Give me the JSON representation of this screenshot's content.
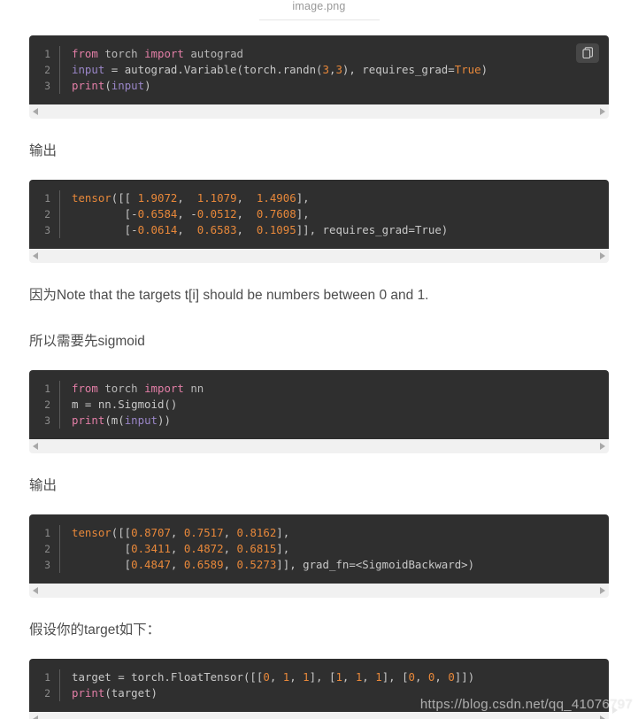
{
  "image_caption": "image.png",
  "copy_button_label": "copy-code",
  "scrollbar": {
    "left_arrow": "◀",
    "right_arrow": "▶"
  },
  "blocks": [
    {
      "kind": "code",
      "id": "code-autograd",
      "has_copy_button": true,
      "lines": [
        {
          "number": "1",
          "tokens": [
            {
              "t": "kw",
              "s": "from"
            },
            {
              "t": "plain",
              "s": " "
            },
            {
              "t": "name",
              "s": "torch"
            },
            {
              "t": "plain",
              "s": " "
            },
            {
              "t": "kw",
              "s": "import"
            },
            {
              "t": "plain",
              "s": " "
            },
            {
              "t": "name",
              "s": "autograd"
            }
          ]
        },
        {
          "number": "2",
          "tokens": [
            {
              "t": "var",
              "s": "input"
            },
            {
              "t": "plain",
              "s": " = autograd.Variable(torch.randn("
            },
            {
              "t": "num",
              "s": "3"
            },
            {
              "t": "plain",
              "s": ","
            },
            {
              "t": "num",
              "s": "3"
            },
            {
              "t": "plain",
              "s": "), requires_grad="
            },
            {
              "t": "bool",
              "s": "True"
            },
            {
              "t": "plain",
              "s": ")"
            }
          ]
        },
        {
          "number": "3",
          "tokens": [
            {
              "t": "kw",
              "s": "print"
            },
            {
              "t": "plain",
              "s": "("
            },
            {
              "t": "var",
              "s": "input"
            },
            {
              "t": "plain",
              "s": ")"
            }
          ]
        }
      ]
    },
    {
      "kind": "para",
      "id": "para-output-1",
      "text": "输出"
    },
    {
      "kind": "code",
      "id": "code-tensor-output",
      "has_copy_button": false,
      "lines": [
        {
          "number": "1",
          "tokens": [
            {
              "t": "tensor",
              "s": "tensor"
            },
            {
              "t": "plain",
              "s": "([[ "
            },
            {
              "t": "num",
              "s": "1.9072"
            },
            {
              "t": "plain",
              "s": ",  "
            },
            {
              "t": "num",
              "s": "1.1079"
            },
            {
              "t": "plain",
              "s": ",  "
            },
            {
              "t": "num",
              "s": "1.4906"
            },
            {
              "t": "plain",
              "s": "],"
            }
          ]
        },
        {
          "number": "2",
          "tokens": [
            {
              "t": "plain",
              "s": "        [-"
            },
            {
              "t": "num",
              "s": "0.6584"
            },
            {
              "t": "plain",
              "s": ", -"
            },
            {
              "t": "num",
              "s": "0.0512"
            },
            {
              "t": "plain",
              "s": ",  "
            },
            {
              "t": "num",
              "s": "0.7608"
            },
            {
              "t": "plain",
              "s": "],"
            }
          ]
        },
        {
          "number": "3",
          "tokens": [
            {
              "t": "plain",
              "s": "        [-"
            },
            {
              "t": "num",
              "s": "0.0614"
            },
            {
              "t": "plain",
              "s": ",  "
            },
            {
              "t": "num",
              "s": "0.6583"
            },
            {
              "t": "plain",
              "s": ",  "
            },
            {
              "t": "num",
              "s": "0.1095"
            },
            {
              "t": "plain",
              "s": "]], requires_grad=True)"
            }
          ]
        }
      ]
    },
    {
      "kind": "para",
      "id": "para-note",
      "text": "因为Note that the targets t[i] should be numbers between 0 and 1."
    },
    {
      "kind": "para",
      "id": "para-sigmoid-note",
      "text": "所以需要先sigmoid"
    },
    {
      "kind": "code",
      "id": "code-sigmoid",
      "has_copy_button": false,
      "lines": [
        {
          "number": "1",
          "tokens": [
            {
              "t": "kw",
              "s": "from"
            },
            {
              "t": "plain",
              "s": " "
            },
            {
              "t": "name",
              "s": "torch"
            },
            {
              "t": "plain",
              "s": " "
            },
            {
              "t": "kw",
              "s": "import"
            },
            {
              "t": "plain",
              "s": " "
            },
            {
              "t": "name",
              "s": "nn"
            }
          ]
        },
        {
          "number": "2",
          "tokens": [
            {
              "t": "plain",
              "s": "m = nn.Sigmoid()"
            }
          ]
        },
        {
          "number": "3",
          "tokens": [
            {
              "t": "kw",
              "s": "print"
            },
            {
              "t": "plain",
              "s": "(m("
            },
            {
              "t": "var",
              "s": "input"
            },
            {
              "t": "plain",
              "s": "))"
            }
          ]
        }
      ]
    },
    {
      "kind": "para",
      "id": "para-output-2",
      "text": "输出"
    },
    {
      "kind": "code",
      "id": "code-sigmoid-output",
      "has_copy_button": false,
      "lines": [
        {
          "number": "1",
          "tokens": [
            {
              "t": "tensor",
              "s": "tensor"
            },
            {
              "t": "plain",
              "s": "([["
            },
            {
              "t": "num",
              "s": "0.8707"
            },
            {
              "t": "plain",
              "s": ", "
            },
            {
              "t": "num",
              "s": "0.7517"
            },
            {
              "t": "plain",
              "s": ", "
            },
            {
              "t": "num",
              "s": "0.8162"
            },
            {
              "t": "plain",
              "s": "],"
            }
          ]
        },
        {
          "number": "2",
          "tokens": [
            {
              "t": "plain",
              "s": "        ["
            },
            {
              "t": "num",
              "s": "0.3411"
            },
            {
              "t": "plain",
              "s": ", "
            },
            {
              "t": "num",
              "s": "0.4872"
            },
            {
              "t": "plain",
              "s": ", "
            },
            {
              "t": "num",
              "s": "0.6815"
            },
            {
              "t": "plain",
              "s": "],"
            }
          ]
        },
        {
          "number": "3",
          "tokens": [
            {
              "t": "plain",
              "s": "        ["
            },
            {
              "t": "num",
              "s": "0.4847"
            },
            {
              "t": "plain",
              "s": ", "
            },
            {
              "t": "num",
              "s": "0.6589"
            },
            {
              "t": "plain",
              "s": ", "
            },
            {
              "t": "num",
              "s": "0.5273"
            },
            {
              "t": "plain",
              "s": "]], grad_fn=<SigmoidBackward>)"
            }
          ]
        }
      ]
    },
    {
      "kind": "para",
      "id": "para-target-intro",
      "text": "假设你的target如下："
    },
    {
      "kind": "code",
      "id": "code-target",
      "has_copy_button": false,
      "lines": [
        {
          "number": "1",
          "tokens": [
            {
              "t": "plain",
              "s": "target = torch.FloatTensor([["
            },
            {
              "t": "num",
              "s": "0"
            },
            {
              "t": "plain",
              "s": ", "
            },
            {
              "t": "num",
              "s": "1"
            },
            {
              "t": "plain",
              "s": ", "
            },
            {
              "t": "num",
              "s": "1"
            },
            {
              "t": "plain",
              "s": "], ["
            },
            {
              "t": "num",
              "s": "1"
            },
            {
              "t": "plain",
              "s": ", "
            },
            {
              "t": "num",
              "s": "1"
            },
            {
              "t": "plain",
              "s": ", "
            },
            {
              "t": "num",
              "s": "1"
            },
            {
              "t": "plain",
              "s": "], ["
            },
            {
              "t": "num",
              "s": "0"
            },
            {
              "t": "plain",
              "s": ", "
            },
            {
              "t": "num",
              "s": "0"
            },
            {
              "t": "plain",
              "s": ", "
            },
            {
              "t": "num",
              "s": "0"
            },
            {
              "t": "plain",
              "s": "]])"
            }
          ]
        },
        {
          "number": "2",
          "tokens": [
            {
              "t": "kw",
              "s": "print"
            },
            {
              "t": "plain",
              "s": "(target)"
            }
          ]
        }
      ]
    }
  ],
  "watermark": "https://blog.csdn.net/qq_41076797",
  "colors": {
    "code_bg": "#2f2f2f",
    "page_bg": "#ffffff",
    "text": "#4d4d4d",
    "keyword": "#e27ea6",
    "number": "#e8883a",
    "variable": "#9a86c8",
    "scrollbar_track": "#f1f1f1"
  }
}
